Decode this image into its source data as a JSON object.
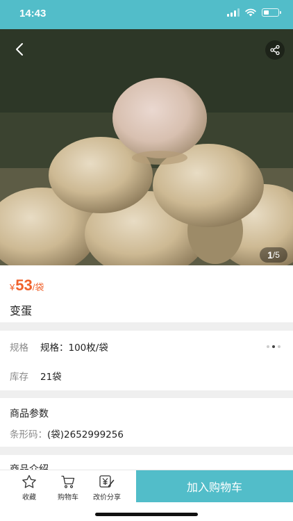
{
  "status_bar": {
    "time": "14:43",
    "icons": [
      "signal-icon",
      "wifi-icon",
      "battery-icon"
    ],
    "background": "#52bdc9"
  },
  "gallery": {
    "current_index": "1",
    "total": "5",
    "separator": "/",
    "back_icon": "chevron-left-icon",
    "share_icon": "share-icon"
  },
  "product": {
    "currency": "¥",
    "price": "53",
    "price_unit": "/袋",
    "title": "变蛋",
    "price_color": "#f0612b"
  },
  "spec": {
    "label": "规格",
    "value": "规格：100枚/袋",
    "stock_label": "库存",
    "stock_value": "21袋"
  },
  "params": {
    "title": "商品参数",
    "barcode_label": "条形码：",
    "barcode_value": "(袋)2652999256"
  },
  "intro": {
    "title": "商品介绍"
  },
  "bottom_bar": {
    "favorite_label": "收藏",
    "cart_label": "购物车",
    "share_label": "改价分享",
    "add_to_cart_label": "加入购物车",
    "accent": "#52bdc9"
  }
}
